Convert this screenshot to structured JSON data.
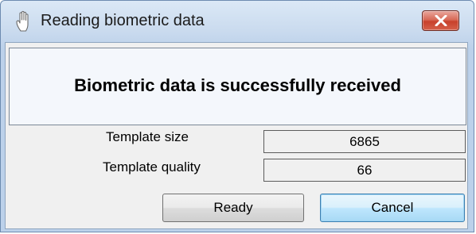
{
  "window": {
    "title": "Reading biometric data",
    "title_icon": "hand-icon",
    "close_icon": "close-icon"
  },
  "message": {
    "text": "Biometric data is successfully received"
  },
  "fields": [
    {
      "label": "Template size",
      "value": "6865"
    },
    {
      "label": "Template quality",
      "value": "66"
    }
  ],
  "buttons": {
    "ready_label": "Ready",
    "cancel_label": "Cancel"
  },
  "colors": {
    "close_button": "#c8412c",
    "title_bar": "#c9daee",
    "focused_button_border": "#3c7fb1"
  }
}
